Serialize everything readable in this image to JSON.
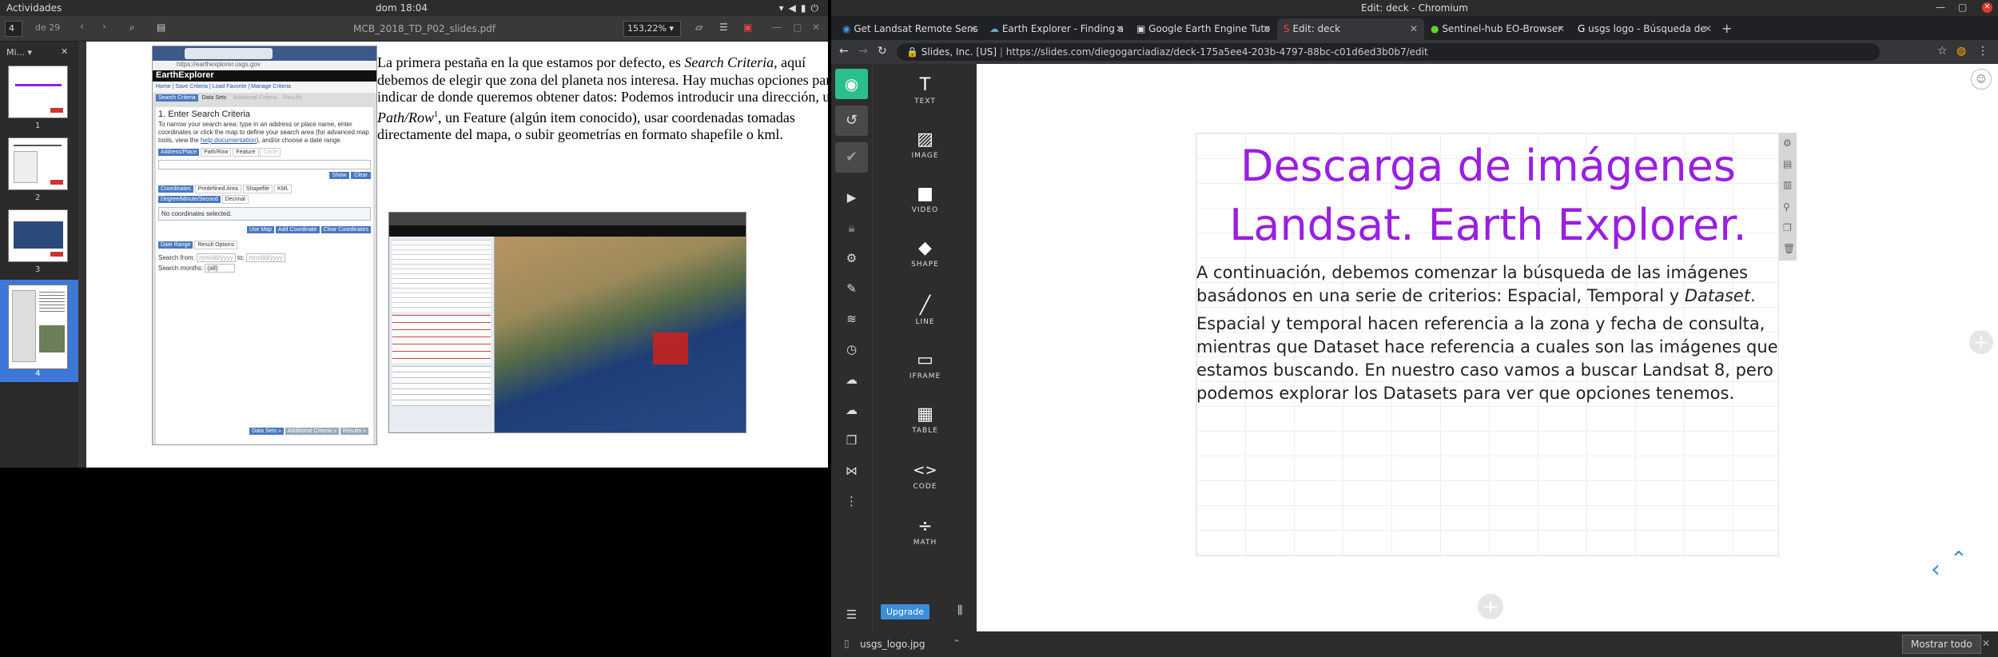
{
  "system": {
    "activities": "Actividades",
    "clock": "dom 18:04"
  },
  "evince": {
    "page_current": "4",
    "page_total": "de 29",
    "file_title": "MCB_2018_TD_P02_slides.pdf",
    "zoom": "153,22%",
    "sidebar_mode": "Mi...",
    "thumb_labels": [
      "1",
      "2",
      "3",
      "4"
    ],
    "page_text_parts": [
      "La primera pestaña en la que estamos por defecto, es ",
      "Search Criteria",
      ", aquí debemos de elegir que zona del planeta nos interesa. Hay muchas opciones para indicar de donde queremos obtener datos: Podemos introducir una dirección, un ",
      "Path/Row",
      "1",
      ", un Feature (algún item conocido), usar coordenadas tomadas directamente del mapa, o subir geometrías en formato shapefile o kml."
    ],
    "screenshot": {
      "url": "https://earthexplorer.usgs.gov",
      "brand": "EarthExplorer",
      "nav": [
        "Home",
        "Save Criteria",
        "Load Favorite",
        "Manage Criteria"
      ],
      "tabs": [
        "Search Criteria",
        "Data Sets",
        "Additional Criteria",
        "Results"
      ],
      "heading": "1. Enter Search Criteria",
      "desc_before_link": "To narrow your search area: type in an address or place name, enter coordinates or click the map to define your search area (for advanced map tools, view the ",
      "desc_link": "help documentation",
      "desc_after_link": "), and/or choose a date range.",
      "subtabs": [
        "Address/Place",
        "Path/Row",
        "Feature",
        "Circle"
      ],
      "show_btn": "Show",
      "clear_btn": "Clear",
      "coord_tabs": [
        "Coordinates",
        "Predefined Area",
        "Shapefile",
        "KML"
      ],
      "coord_modes": [
        "Degree/Minute/Second",
        "Decimal"
      ],
      "no_coords": "No coordinates selected.",
      "coord_buttons": [
        "Use Map",
        "Add Coordinate",
        "Clear Coordinates"
      ],
      "date_tabs": [
        "Date Range",
        "Result Options"
      ],
      "search_from": "Search from:",
      "date_ph": "mm/dd/yyyy",
      "to": "to:",
      "search_months": "Search months:",
      "months_value": "(all)",
      "footer_buttons": [
        "Data Sets »",
        "Additional Criteria »",
        "Results »"
      ]
    }
  },
  "chromium": {
    "window_title": "Edit: deck - Chromium",
    "tabs": [
      {
        "label": "Get Landsat Remote Sens",
        "active": false
      },
      {
        "label": "Earth Explorer - Finding a",
        "active": false
      },
      {
        "label": "Google Earth Engine Tuto",
        "active": false
      },
      {
        "label": "Edit: deck",
        "active": true
      },
      {
        "label": "Sentinel-hub EO-Browser",
        "active": false
      },
      {
        "label": "usgs logo - Búsqueda de",
        "active": false
      }
    ],
    "site_owner": "Slides, Inc. [US]",
    "url": "https://slides.com/diegogarciadiaz/deck-175a5ee4-203b-4797-88bc-c01d6ed3b0b7/edit"
  },
  "editor": {
    "blocks": [
      {
        "icon": "T",
        "label": "TEXT"
      },
      {
        "icon": "▨",
        "label": "IMAGE"
      },
      {
        "icon": "■",
        "label": "VIDEO"
      },
      {
        "icon": "◆",
        "label": "SHAPE"
      },
      {
        "icon": "╱",
        "label": "LINE"
      },
      {
        "icon": "▭",
        "label": "IFRAME"
      },
      {
        "icon": "▦",
        "label": "TABLE"
      },
      {
        "icon": "<>",
        "label": "CODE"
      },
      {
        "icon": "÷",
        "label": "MATH"
      }
    ],
    "upgrade": "Upgrade",
    "slide": {
      "title_line1": "Descarga de imágenes",
      "title_line2": "Landsat. Earth Explorer.",
      "p1_before": "A continuación, debemos comenzar la búsqueda de las imágenes basádonos en una serie de criterios: Espacial, Temporal y ",
      "p1_italic": "Dataset",
      "p1_after": ".",
      "p2": "Espacial y temporal hacen referencia a la zona y fecha de consulta, mientras que Dataset hace referencia a cuales son las imágenes que estamos buscando. En nuestro caso vamos a buscar Landsat 8, pero podemos explorar los Datasets para ver que opciones tenemos."
    },
    "title_color": "#9a1fe0"
  },
  "downloads": {
    "file": "usgs_logo.jpg",
    "show_all": "Mostrar todo"
  }
}
